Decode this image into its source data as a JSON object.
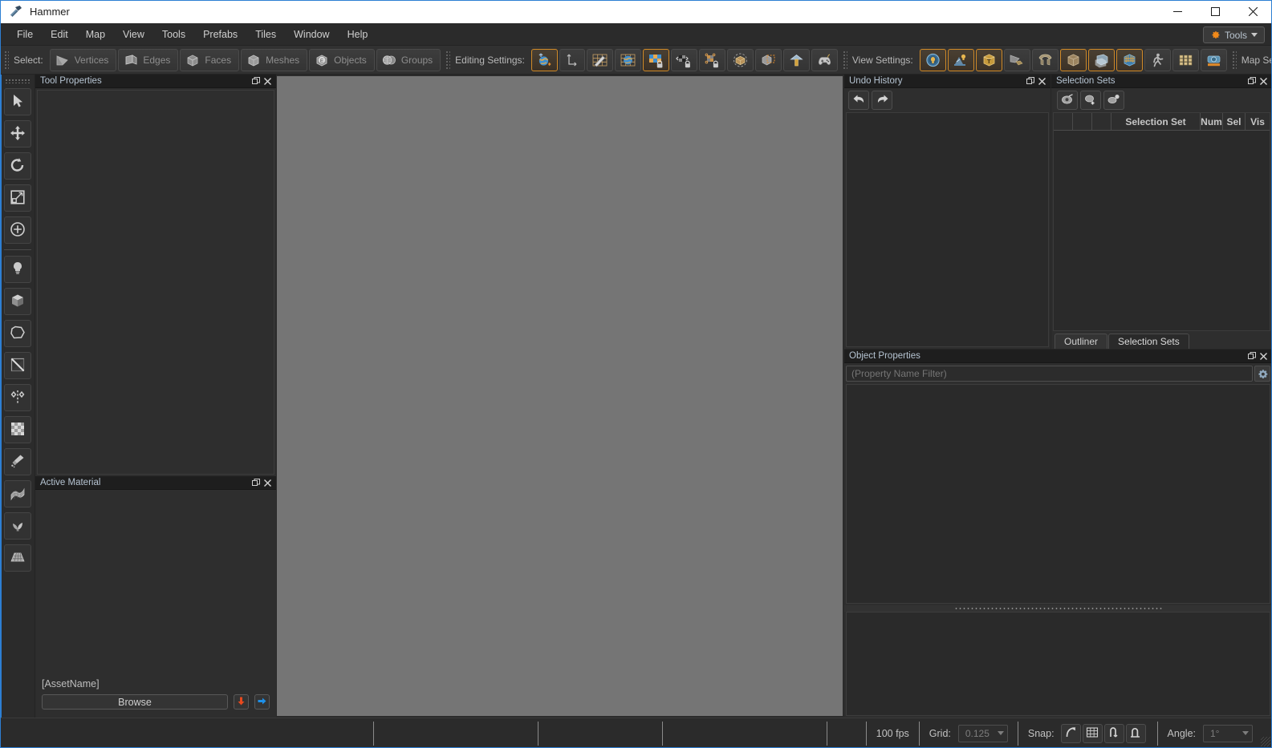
{
  "window": {
    "title": "Hammer",
    "app_icon": "hammer-icon",
    "minimize": "—",
    "maximize": "☐",
    "close": "✕"
  },
  "menubar": {
    "items": [
      {
        "label": "File",
        "name": "menu-file"
      },
      {
        "label": "Edit",
        "name": "menu-edit"
      },
      {
        "label": "Map",
        "name": "menu-map"
      },
      {
        "label": "View",
        "name": "menu-view"
      },
      {
        "label": "Tools",
        "name": "menu-tools"
      },
      {
        "label": "Prefabs",
        "name": "menu-prefabs"
      },
      {
        "label": "Tiles",
        "name": "menu-tiles"
      },
      {
        "label": "Window",
        "name": "menu-window"
      },
      {
        "label": "Help",
        "name": "menu-help"
      }
    ],
    "tools_button": {
      "label": "Tools",
      "icon": "gear-icon",
      "caret": "chevron-down-icon"
    }
  },
  "toolbar": {
    "select_group": {
      "label": "Select:",
      "buttons": [
        {
          "label": "Vertices",
          "icon": "vertices-icon",
          "active": false
        },
        {
          "label": "Edges",
          "icon": "edges-icon",
          "active": false
        },
        {
          "label": "Faces",
          "icon": "faces-icon",
          "active": false
        },
        {
          "label": "Meshes",
          "icon": "meshes-icon",
          "active": false
        },
        {
          "label": "Objects",
          "icon": "objects-icon",
          "active": false
        },
        {
          "label": "Groups",
          "icon": "groups-icon",
          "active": false
        }
      ]
    },
    "editing_group": {
      "label": "Editing Settings:",
      "buttons": [
        {
          "icon": "world-space-icon",
          "active": true
        },
        {
          "icon": "local-space-icon",
          "active": false
        },
        {
          "icon": "snap-to-grid-icon",
          "active": false
        },
        {
          "icon": "world-grid-icon",
          "active": false
        },
        {
          "icon": "texture-lock-icon",
          "active": true
        },
        {
          "icon": "texture-shift-lock-icon",
          "active": false
        },
        {
          "icon": "texture-scale-lock-icon",
          "active": false
        },
        {
          "icon": "bounds-display-icon",
          "active": false
        },
        {
          "icon": "selection-box-icon",
          "active": false
        },
        {
          "icon": "nodraw-tool-icon",
          "active": false
        },
        {
          "icon": "gamepad-icon",
          "active": false
        }
      ]
    },
    "view_group": {
      "label": "View Settings:",
      "buttons": [
        {
          "icon": "lighting-preview-icon",
          "active": true
        },
        {
          "icon": "entity-lights-icon",
          "active": true
        },
        {
          "icon": "show-triggers-icon",
          "active": true
        },
        {
          "icon": "show-helpers-icon",
          "active": false
        },
        {
          "icon": "show-props-icon",
          "active": false
        },
        {
          "icon": "show-models-icon",
          "active": true
        },
        {
          "icon": "wireframe-over-icon",
          "active": true
        },
        {
          "icon": "grid-overlay-icon",
          "active": true
        },
        {
          "icon": "player-clip-icon",
          "active": false
        },
        {
          "icon": "texture-grid-icon",
          "active": false
        },
        {
          "icon": "camera-icon",
          "active": false
        }
      ]
    },
    "map_group": {
      "label": "Map Settings:",
      "buttons": [
        {
          "icon": "map-geometry-icon",
          "active": false
        }
      ],
      "overflow": "»"
    }
  },
  "tool_rail": {
    "items": [
      {
        "name": "select-tool",
        "icon": "cursor-arrow-icon"
      },
      {
        "name": "translate-tool",
        "icon": "move-arrows-icon"
      },
      {
        "name": "rotate-tool",
        "icon": "rotate-arrow-icon"
      },
      {
        "name": "scale-tool",
        "icon": "scale-box-icon"
      },
      {
        "name": "pivot-tool",
        "icon": "target-plus-icon"
      },
      {
        "name": "entity-tool",
        "icon": "lightbulb-icon"
      },
      {
        "name": "block-tool",
        "icon": "cube-icon"
      },
      {
        "name": "polygon-tool",
        "icon": "polygon-icon"
      },
      {
        "name": "clip-tool",
        "icon": "clip-plane-icon"
      },
      {
        "name": "mirror-tool",
        "icon": "mirror-icon"
      },
      {
        "name": "texture-tool",
        "icon": "checker-icon"
      },
      {
        "name": "paint-tool",
        "icon": "paintbrush-icon"
      },
      {
        "name": "displacement-tool",
        "icon": "displacement-icon"
      },
      {
        "name": "foliage-tool",
        "icon": "plant-icon"
      },
      {
        "name": "tile-mesh-tool",
        "icon": "tile-grid-icon"
      }
    ]
  },
  "panels": {
    "tool_properties": {
      "title": "Tool Properties",
      "float_icon": "float-icon",
      "close_icon": "close-icon"
    },
    "active_material": {
      "title": "Active Material",
      "float_icon": "float-icon",
      "close_icon": "close-icon",
      "asset_name": "[AssetName]",
      "browse_label": "Browse",
      "import_icon": "import-arrow-icon",
      "goto_icon": "goto-arrow-icon"
    },
    "undo_history": {
      "title": "Undo History",
      "float_icon": "float-icon",
      "close_icon": "close-icon",
      "undo_icon": "undo-arrow-icon",
      "redo_icon": "redo-arrow-icon",
      "entries": []
    },
    "selection_sets": {
      "title": "Selection Sets",
      "float_icon": "float-icon",
      "close_icon": "close-icon",
      "toolbar_icons": [
        "select-set-icon",
        "add-set-icon",
        "remove-set-icon"
      ],
      "columns": [
        "",
        "",
        "",
        "Selection Set",
        "Num",
        "Sel",
        "Vis"
      ],
      "rows": [],
      "tabs": [
        {
          "label": "Outliner",
          "active": false
        },
        {
          "label": "Selection Sets",
          "active": true
        }
      ]
    },
    "object_properties": {
      "title": "Object Properties",
      "float_icon": "float-icon",
      "close_icon": "close-icon",
      "filter_placeholder": "(Property Name Filter)",
      "filter_value": "",
      "settings_icon": "gear-icon",
      "rows": []
    }
  },
  "statusbar": {
    "cells": [
      "",
      "",
      "",
      "",
      ""
    ],
    "fps": "100 fps",
    "grid_label": "Grid:",
    "grid_value": "0.125",
    "snap_label": "Snap:",
    "snap_buttons": [
      "snap-rotate-icon",
      "snap-grid-icon",
      "snap-vertex-icon",
      "snap-surface-icon"
    ],
    "angle_label": "Angle:",
    "angle_value": "1°"
  },
  "colors": {
    "accent": "#d08a28",
    "focus_border": "#2d7fd3",
    "viewport": "#757575",
    "panel_bg": "#2e2e2e",
    "titlebar_bg": "#ffffff"
  }
}
